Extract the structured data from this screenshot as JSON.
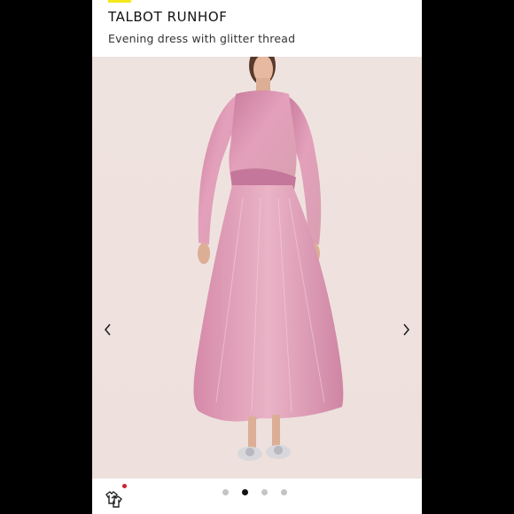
{
  "product": {
    "brand": "TALBOT RUNHOF",
    "title": "Evening dress with glitter thread"
  },
  "gallery": {
    "current_index": 2,
    "total_images": 4,
    "prev_icon": "chevron-left-icon",
    "next_icon": "chevron-right-icon"
  },
  "footer": {
    "compare_icon": "compare-garments-icon"
  },
  "colors": {
    "accent": "#f5e81a",
    "dress": "#d98aa8",
    "background": "#efe2de",
    "notification": "#d0202a"
  }
}
